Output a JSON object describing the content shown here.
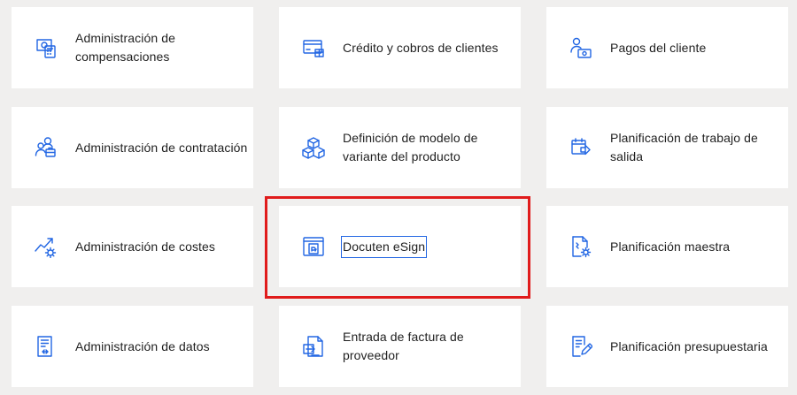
{
  "colors": {
    "background": "#f0efee",
    "tile": "#ffffff",
    "accent": "#2266e3",
    "highlight": "#e01b1b",
    "text": "#1f1f1f"
  },
  "tiles": [
    {
      "label": "Administración de compensaciones",
      "icon": "compensation-icon"
    },
    {
      "label": "Crédito y cobros de clientes",
      "icon": "credit-card-icon"
    },
    {
      "label": "Pagos del cliente",
      "icon": "customer-payment-icon"
    },
    {
      "label": "Administración de contratación",
      "icon": "recruitment-icon"
    },
    {
      "label": "Definición de modelo de variante del producto",
      "icon": "product-variant-icon"
    },
    {
      "label": "Planificación de trabajo de salida",
      "icon": "outbound-work-icon"
    },
    {
      "label": "Administración de costes",
      "icon": "cost-trend-icon"
    },
    {
      "label": "Docuten eSign",
      "icon": "esign-document-icon"
    },
    {
      "label": "Planificación maestra",
      "icon": "master-planning-icon"
    },
    {
      "label": "Administración de datos",
      "icon": "data-management-icon"
    },
    {
      "label": "Entrada de factura de proveedor",
      "icon": "vendor-invoice-icon"
    },
    {
      "label": "Planificación presupuestaria",
      "icon": "budget-planning-icon"
    }
  ]
}
